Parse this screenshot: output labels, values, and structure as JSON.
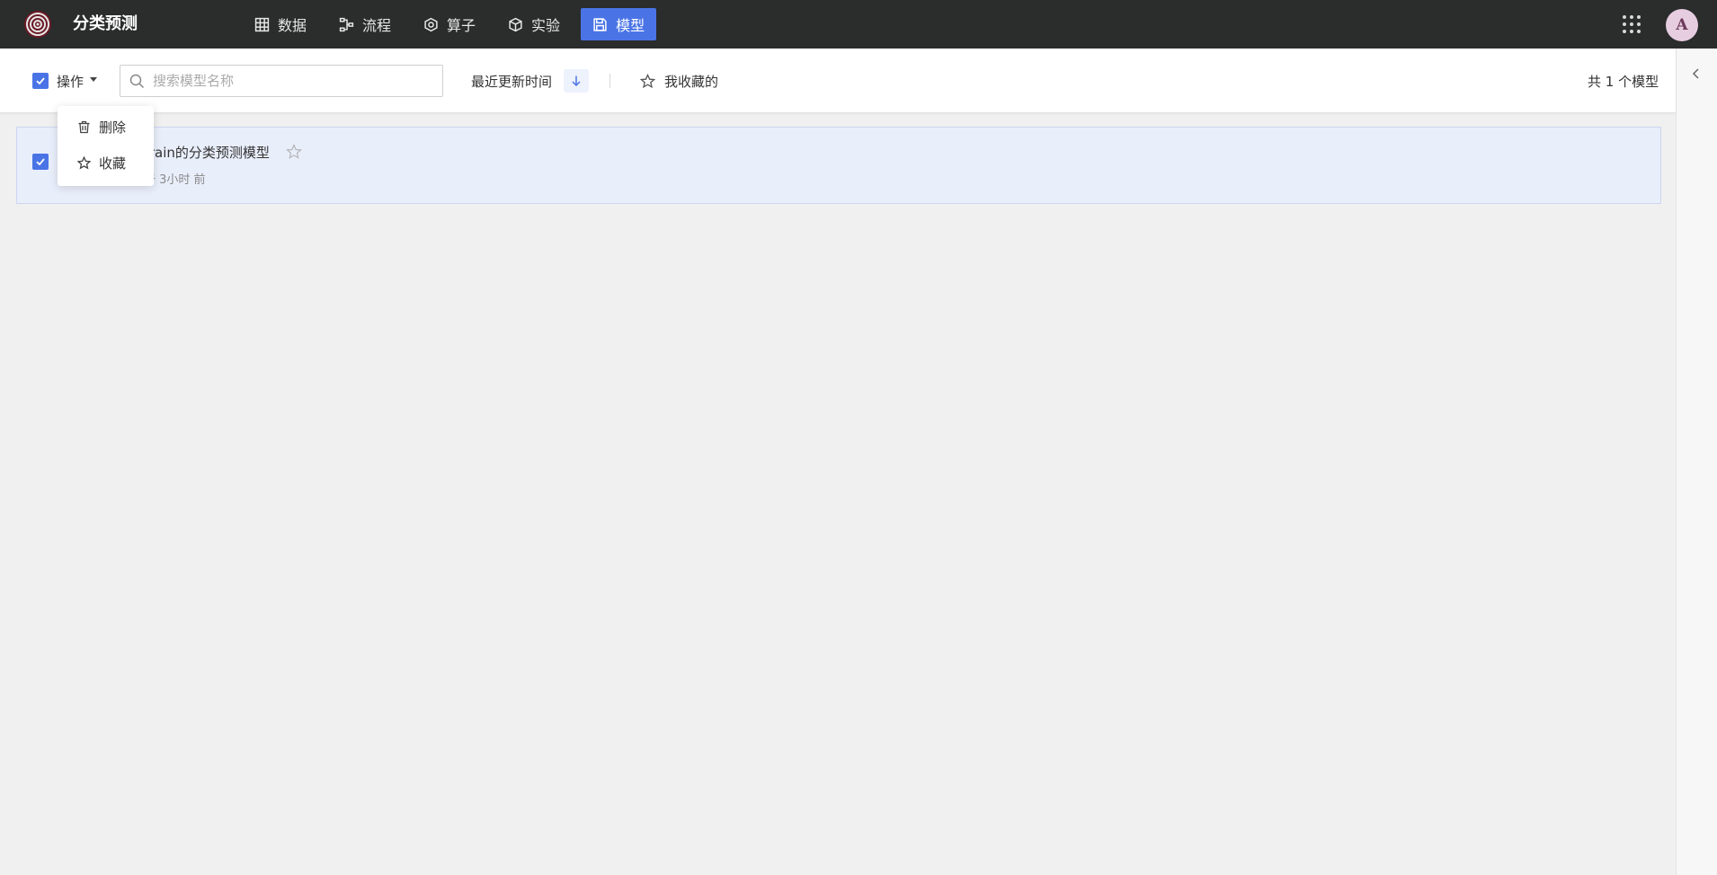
{
  "app": {
    "title": "分类预测"
  },
  "nav": {
    "items": [
      {
        "label": "数据",
        "icon": "table-icon",
        "active": false
      },
      {
        "label": "流程",
        "icon": "flow-icon",
        "active": false
      },
      {
        "label": "算子",
        "icon": "hexagon-icon",
        "active": false
      },
      {
        "label": "实验",
        "icon": "cube-icon",
        "active": false
      },
      {
        "label": "模型",
        "icon": "save-icon",
        "active": true
      }
    ]
  },
  "user": {
    "avatar_letter": "A"
  },
  "toolbar": {
    "ops_label": "操作",
    "search_placeholder": "搜索模型名称",
    "search_value": "",
    "sort_label": "最近更新时间",
    "favorites_label": "我收藏的",
    "count_label": "共 1 个模型"
  },
  "dropdown": {
    "items": [
      {
        "label": "删除",
        "icon": "trash-icon"
      },
      {
        "label": "收藏",
        "icon": "star-icon"
      }
    ]
  },
  "models": [
    {
      "name": "train的分类预测模型",
      "updated": "于 3小时 前"
    }
  ],
  "colors": {
    "topbar": "#2b2c2c",
    "accent": "#4a74e6",
    "row_selected": "#e9eefb"
  }
}
